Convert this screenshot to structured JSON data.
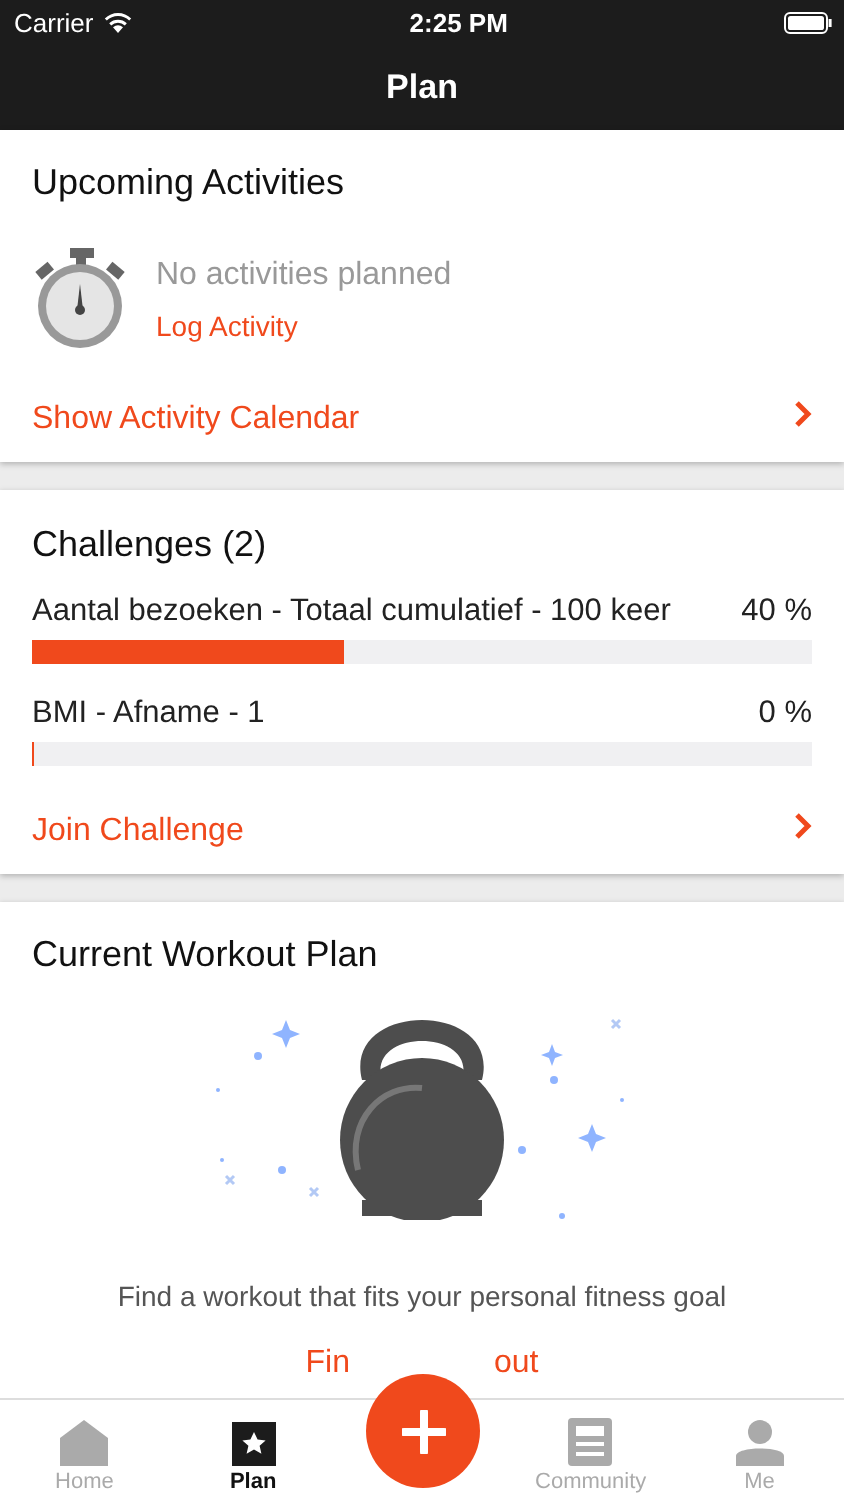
{
  "status_bar": {
    "carrier": "Carrier",
    "time": "2:25 PM"
  },
  "nav": {
    "title": "Plan"
  },
  "upcoming": {
    "title": "Upcoming Activities",
    "empty_text": "No activities planned",
    "log_link": "Log Activity",
    "calendar_link": "Show Activity Calendar"
  },
  "challenges": {
    "title": "Challenges (2)",
    "items": [
      {
        "name": "Aantal bezoeken - Totaal cumulatief - 100 keer",
        "percent": "40 %",
        "level": 0.4
      },
      {
        "name": "BMI - Afname - 1",
        "percent": "0 %",
        "level": 0
      }
    ],
    "join_link": "Join Challenge"
  },
  "workout": {
    "title": "Current Workout Plan",
    "message": "Find a workout that fits your personal fitness goal",
    "link_parts": [
      "Fin",
      "out"
    ]
  },
  "tabs": [
    {
      "kind": "home",
      "label": "Home",
      "selected": false
    },
    {
      "kind": "plan",
      "label": "Plan",
      "selected": true
    },
    {
      "kind": "add"
    },
    {
      "kind": "community",
      "label": "Community",
      "selected": false
    },
    {
      "kind": "me",
      "label": "Me",
      "selected": false
    }
  ]
}
